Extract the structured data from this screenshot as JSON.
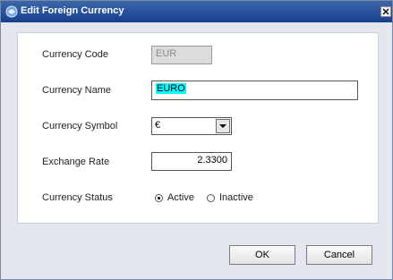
{
  "window": {
    "title": "Edit Foreign Currency",
    "close_label": "x"
  },
  "form": {
    "code_label": "Currency Code",
    "code_value": "EUR",
    "name_label": "Currency Name",
    "name_value": "EURO",
    "symbol_label": "Currency Symbol",
    "symbol_value": "€",
    "rate_label": "Exchange Rate",
    "rate_value": "2.3300",
    "status_label": "Currency Status",
    "status_options": [
      "Active",
      "Inactive"
    ],
    "status_selected": "Active"
  },
  "buttons": {
    "ok_label": "OK",
    "cancel_label": "Cancel"
  }
}
